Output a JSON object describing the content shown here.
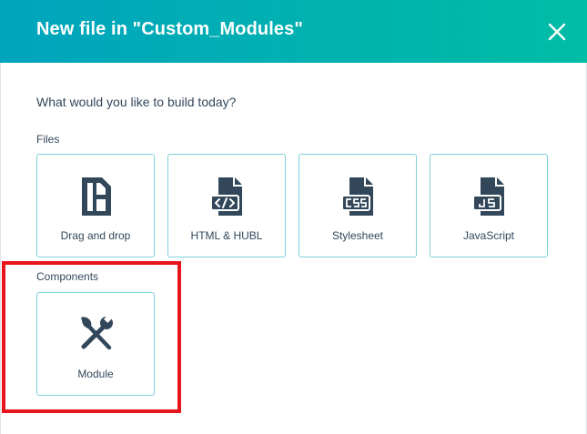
{
  "dialog": {
    "title": "New file in \"Custom_Modules\"",
    "close_icon": "close-icon",
    "header_gradient": [
      "#00a4bd",
      "#00bda5"
    ]
  },
  "prompt": "What would you like to build today?",
  "files": {
    "label": "Files",
    "items": [
      {
        "label": "Drag and drop",
        "icon": "drag-and-drop-layout-icon"
      },
      {
        "label": "HTML & HUBL",
        "icon": "html-code-file-icon"
      },
      {
        "label": "Stylesheet",
        "icon": "css-file-icon"
      },
      {
        "label": "JavaScript",
        "icon": "js-file-icon"
      }
    ]
  },
  "components": {
    "label": "Components",
    "items": [
      {
        "label": "Module",
        "icon": "brush-and-wrench-icon"
      }
    ]
  },
  "colors": {
    "text": "#33475b",
    "icon": "#33475b",
    "card_border": "#7fd1de",
    "highlight": "#e8141b"
  }
}
